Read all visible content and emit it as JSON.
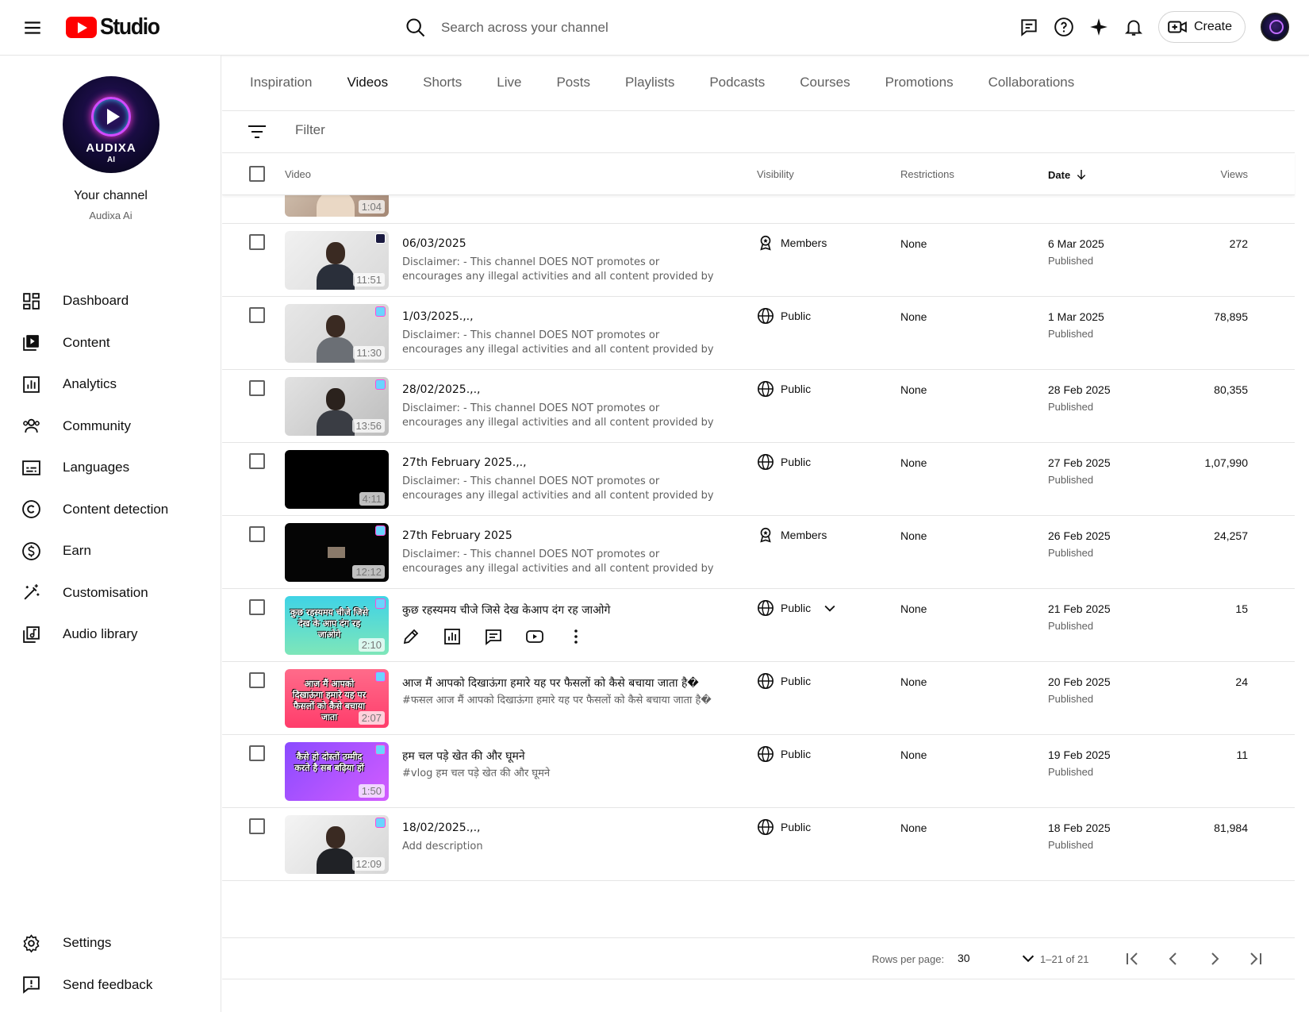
{
  "app": {
    "logo_text": "Studio",
    "brand_color": "#ff0000"
  },
  "header": {
    "search_placeholder": "Search across your channel",
    "create_label": "Create",
    "icons": [
      "feedback-icon",
      "help-icon",
      "sparkle-icon",
      "notifications-icon",
      "create-video-icon"
    ]
  },
  "sidebar": {
    "avatar_text": "AUDIXA",
    "avatar_subtext": "AI",
    "your_channel": "Your channel",
    "channel_name": "Audixa Ai",
    "items": [
      {
        "label": "Dashboard",
        "icon": "dashboard-icon"
      },
      {
        "label": "Content",
        "icon": "content-icon"
      },
      {
        "label": "Analytics",
        "icon": "analytics-icon"
      },
      {
        "label": "Community",
        "icon": "community-icon"
      },
      {
        "label": "Languages",
        "icon": "subtitles-icon"
      },
      {
        "label": "Content detection",
        "icon": "copyright-icon"
      },
      {
        "label": "Earn",
        "icon": "dollar-icon"
      },
      {
        "label": "Customisation",
        "icon": "magic-wand-icon"
      },
      {
        "label": "Audio library",
        "icon": "audio-library-icon"
      }
    ],
    "bottom": [
      {
        "label": "Settings",
        "icon": "gear-icon"
      },
      {
        "label": "Send feedback",
        "icon": "feedback-icon"
      }
    ]
  },
  "tabs": [
    "Inspiration",
    "Videos",
    "Shorts",
    "Live",
    "Posts",
    "Playlists",
    "Podcasts",
    "Courses",
    "Promotions",
    "Collaborations"
  ],
  "active_tab": "Videos",
  "filter": {
    "placeholder": "Filter"
  },
  "table": {
    "headers": {
      "video": "Video",
      "visibility": "Visibility",
      "restrictions": "Restrictions",
      "date": "Date",
      "views": "Views"
    },
    "partial_row": {
      "duration": "1:04"
    },
    "rows": [
      {
        "title": "06/03/2025",
        "description": "Disclaimer: - This channel DOES NOT promotes or encourages any illegal activities and all content provided by this channel is mean…",
        "duration": "11:51",
        "visibility": "Members",
        "restrictions": "None",
        "date": "6 Mar 2025",
        "status": "Published",
        "views": "272"
      },
      {
        "title": "1/03/2025.,.,",
        "description": "Disclaimer: - This channel DOES NOT promotes or encourages any illegal activities and all content provided by this channel is mean…",
        "duration": "11:30",
        "visibility": "Public",
        "restrictions": "None",
        "date": "1 Mar 2025",
        "status": "Published",
        "views": "78,895"
      },
      {
        "title": "28/02/2025.,.,",
        "description": "Disclaimer: - This channel DOES NOT promotes or encourages any illegal activities and all content provided by this channel is mean…",
        "duration": "13:56",
        "visibility": "Public",
        "restrictions": "None",
        "date": "28 Feb 2025",
        "status": "Published",
        "views": "80,355"
      },
      {
        "title": "27th February 2025.,.,",
        "description": "Disclaimer: - This channel DOES NOT promotes or encourages any illegal activities and all content provided by this channel is mean…",
        "duration": "4:11",
        "visibility": "Public",
        "restrictions": "None",
        "date": "27 Feb 2025",
        "status": "Published",
        "views": "1,07,990"
      },
      {
        "title": "27th February 2025",
        "description": "Disclaimer: - This channel DOES NOT promotes or encourages any illegal activities and all content provided by this channel is mean…",
        "duration": "12:12",
        "visibility": "Members",
        "restrictions": "None",
        "date": "26 Feb 2025",
        "status": "Published",
        "views": "24,257"
      },
      {
        "title": "कुछ रहस्यमय चीजे जिसे देख केआप दंग रह जाओगे",
        "description": "",
        "duration": "2:10",
        "visibility": "Public",
        "restrictions": "None",
        "date": "21 Feb 2025",
        "status": "Published",
        "views": "15",
        "thumb_text": "कुछ रहस्यमय चीजे जिसे देख के आप दंग रह जाओगे"
      },
      {
        "title": "आज मैं आपको दिखाऊंगा हमारे यह पर फैसलों को कैसे बचाया जाता है�",
        "description": "#फसल आज मैं आपको दिखाऊंगा हमारे यह पर फैसलों को कैसे बचाया जाता है�",
        "duration": "2:07",
        "visibility": "Public",
        "restrictions": "None",
        "date": "20 Feb 2025",
        "status": "Published",
        "views": "24",
        "thumb_text": "आज मैं आपको दिखाऊंगा हमारे यह पर फैसलों को कैसे बचाया जाता"
      },
      {
        "title": "हम चल पड़े खेत की और घूमने",
        "description": "#vlog हम चल पड़े खेत की और घूमने",
        "duration": "1:50",
        "visibility": "Public",
        "restrictions": "None",
        "date": "19 Feb 2025",
        "status": "Published",
        "views": "11",
        "thumb_text": "कैसे हो दोस्तों उम्मीद करते है सब बढ़िया हों"
      },
      {
        "title": "18/02/2025.,.,",
        "description": "Add description",
        "duration": "12:09",
        "visibility": "Public",
        "restrictions": "None",
        "date": "18 Feb 2025",
        "status": "Published",
        "views": "81,984"
      }
    ]
  },
  "pagination": {
    "rows_per_page_label": "Rows per page:",
    "rows_per_page": "30",
    "range": "1–21 of 21"
  }
}
